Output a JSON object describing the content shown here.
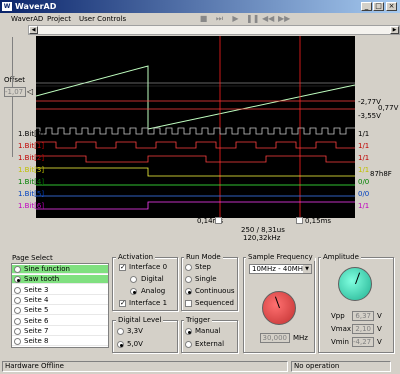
{
  "app": {
    "title": "WaverAD",
    "icon": "waverad-app-icon"
  },
  "window_buttons": {
    "minimize": "_",
    "maximize": "□",
    "close": "×"
  },
  "menu": [
    "WaverAD",
    "Project",
    "User Controls"
  ],
  "toolbar": [
    "stop-icon",
    "step-icon",
    "play-icon",
    "pause-icon",
    "rewind-icon",
    "forward-icon"
  ],
  "offset": {
    "label": "Offset",
    "value": "-1,07"
  },
  "scope": {
    "voltage_labels": [
      "-2,77V",
      "0,77V",
      "-3,55V"
    ],
    "bit_labels": [
      "1.Bit[0]",
      "1.Bit[1]",
      "1.Bit[2]",
      "1.Bit[3]",
      "1.Bit[4]",
      "1.Bit[5]",
      "1.Bit[6]"
    ],
    "bit_colors": [
      "#c8c8c8",
      "#ff4040",
      "#ff4040",
      "#ffff40",
      "#40ff40",
      "#4080ff",
      "#ff40ff"
    ],
    "right_values": [
      "1/1",
      "1/1",
      "1/1",
      "1/1",
      "0/0",
      "0/0",
      "1/1"
    ],
    "hex_value": "87h8F",
    "cursor_left": "0,14ms",
    "cursor_right": "0,15ms",
    "sample_info": "250 / 8,31us",
    "frequency": "120,32kHz"
  },
  "page_select": {
    "title": "Page Select",
    "pages": [
      {
        "label": "Sine function",
        "selected": false,
        "highlight": true
      },
      {
        "label": "Saw tooth",
        "selected": true,
        "highlight": true
      },
      {
        "label": "Seite 3",
        "selected": false,
        "highlight": false
      },
      {
        "label": "Seite 4",
        "selected": false,
        "highlight": false
      },
      {
        "label": "Seite 5",
        "selected": false,
        "highlight": false
      },
      {
        "label": "Seite 6",
        "selected": false,
        "highlight": false
      },
      {
        "label": "Seite 7",
        "selected": false,
        "highlight": false
      },
      {
        "label": "Seite 8",
        "selected": false,
        "highlight": false
      }
    ]
  },
  "activation": {
    "title": "Activation",
    "interface0": "Interface 0",
    "digital": "Digital",
    "analog": "Analog",
    "interface1": "Interface 1"
  },
  "digital_level": {
    "title": "Digital Level",
    "v33": "3,3V",
    "v50": "5,0V"
  },
  "run_mode": {
    "title": "Run Mode",
    "step": "Step",
    "single": "Single",
    "continuous": "Continuous",
    "sequenced": "Sequenced"
  },
  "trigger": {
    "title": "Trigger",
    "manual": "Manual",
    "external": "External"
  },
  "sample_frequency": {
    "title": "Sample Frequency",
    "selected": "10MHz - 40MHz",
    "value": "30,000",
    "unit": "MHz"
  },
  "amplitude": {
    "title": "Amplitude",
    "vpp_label": "Vpp",
    "vpp": "6,37",
    "vpp_unit": "V",
    "vmax_label": "Vmax",
    "vmax": "2,10",
    "vmax_unit": "V",
    "vmin_label": "Vmin",
    "vmin": "-4,27",
    "vmin_unit": "V"
  },
  "status": {
    "left": "Hardware Offline",
    "right": "No operation"
  }
}
